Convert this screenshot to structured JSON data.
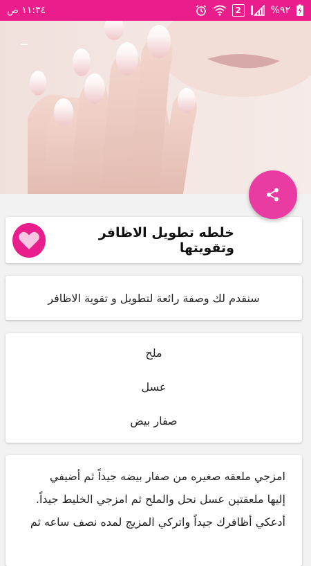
{
  "status_bar": {
    "time": "١١:٣٤ ص",
    "battery": "%٩٢",
    "sim": "2",
    "icons": [
      "battery-charging-icon",
      "signal-icon",
      "sim-2-icon",
      "wifi-icon",
      "alarm-icon"
    ],
    "color": "#e91e8c"
  },
  "hero": {
    "image": "hands-with-long-nails-photo"
  },
  "fab": {
    "icon": "share-icon",
    "color": "#ea3ba2"
  },
  "title_card": {
    "title": "خلطه تطويل الاظافر وتقويتها",
    "favorite_icon": "heart-icon"
  },
  "intro": {
    "text": "سنقدم لك وصفة رائعة لتطويل و تقوية الاظافر"
  },
  "ingredients": [
    "ملح",
    "عسل",
    "صفار بيض"
  ],
  "steps": {
    "lines": [
      "امزجي ملعقه صغيره من صفار بيضه جيداً ثم أضيفي",
      "إليها ملعقتين عسل نحل والملح ثم امزجي الخليط جيداً.",
      "أدعكي أظافرك جيداً واتركي المزيج لمده نصف ساعه ثم"
    ]
  }
}
